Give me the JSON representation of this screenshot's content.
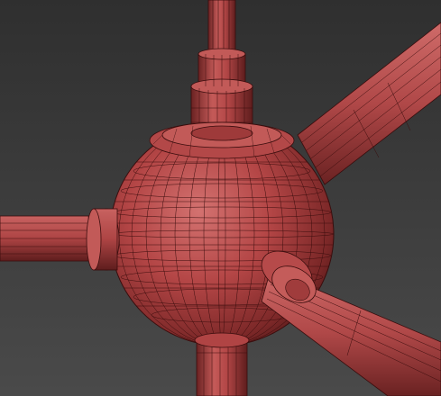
{
  "scene": {
    "background_color": "#3b3b3b",
    "background_gradient_top": "#2f2f2f",
    "background_gradient_bottom": "#4a4a4a",
    "model_color": "#b84848",
    "model_highlight": "#d06a68",
    "model_shadow": "#5a1c1c",
    "wire_color": "#3a0d0d",
    "render_mode": "wireframe-on-shaded",
    "model_parts": [
      "sphere-hub",
      "top-collar",
      "top-rod",
      "bottom-rod",
      "left-rod",
      "right-upper-rod",
      "right-lower-rod"
    ]
  }
}
